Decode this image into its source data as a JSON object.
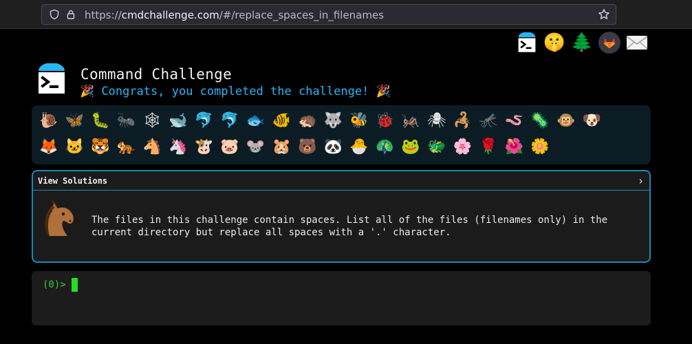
{
  "browser": {
    "url_prefix": "https://",
    "url_domain": "cmdchallenge.com",
    "url_path": "/#/replace_spaces_in_filenames",
    "icons": [
      "shield-icon",
      "lock-icon",
      "star-icon"
    ]
  },
  "top_icons": [
    {
      "name": "terminal-logo-icon",
      "glyph": ""
    },
    {
      "name": "shushing-face-icon",
      "glyph": "🤫"
    },
    {
      "name": "tree-icon",
      "glyph": "🌲"
    },
    {
      "name": "gitlab-icon",
      "glyph": ""
    },
    {
      "name": "envelope-icon",
      "glyph": "✉"
    }
  ],
  "header": {
    "title": "Command Challenge",
    "congrats": "🎉 Congrats, you completed the challenge! 🎉"
  },
  "animals": {
    "row1": [
      "🐌",
      "🦋",
      "🐛",
      "🐜",
      "🕸",
      "🐋",
      "🐬",
      "🐬",
      "🐟",
      "🐠",
      "🦔",
      "🐺",
      "🐝",
      "🐞",
      "🦗",
      "🕷",
      "🦂",
      "🦟",
      "🪱",
      "🦠",
      "🐵",
      "🐶"
    ],
    "row2": [
      "🦊",
      "🐱",
      "🐯",
      "🐅",
      "🐴",
      "🦄",
      "🐮",
      "🐷",
      "🐭",
      "🐹",
      "🐻",
      "🐼",
      "🐣",
      "🦚",
      "🐸",
      "🐲",
      "🌸",
      "🌹",
      "🌺",
      "🌼"
    ]
  },
  "solutions": {
    "title": "View Solutions",
    "chevron": "›",
    "description": "The files in this challenge contain spaces. List all of the files (filenames only) in the current directory but replace all spaces with a '.' character."
  },
  "terminal": {
    "prompt": "(0)>"
  },
  "colors": {
    "accent": "#29b6f6",
    "border": "#1e88b8",
    "prompt": "#2ecc40"
  }
}
